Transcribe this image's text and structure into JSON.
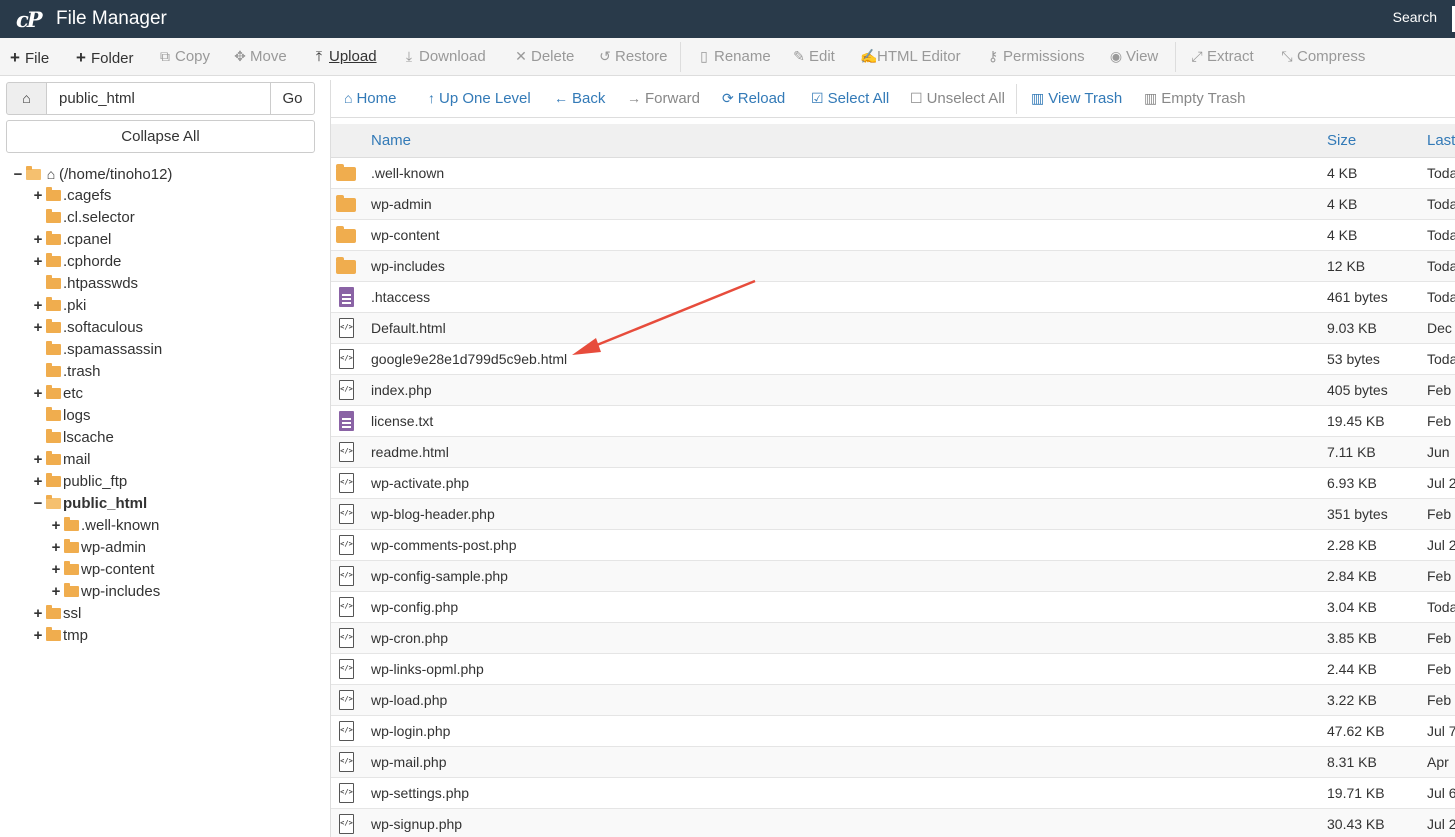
{
  "header": {
    "logo": "cP",
    "title": "File Manager",
    "search_label": "Search"
  },
  "toolbar": [
    {
      "label": "File",
      "icon": "plus-icon",
      "glyph": "+",
      "state": "on"
    },
    {
      "label": "Folder",
      "icon": "plus-icon",
      "glyph": "+",
      "state": "on"
    },
    {
      "label": "Copy",
      "icon": "copy-icon",
      "glyph": "⧉",
      "state": "off"
    },
    {
      "label": "Move",
      "icon": "move-icon",
      "glyph": "✥",
      "state": "off"
    },
    {
      "label": "Upload",
      "icon": "upload-icon",
      "glyph": "⤒",
      "state": "on"
    },
    {
      "label": "Download",
      "icon": "download-icon",
      "glyph": "⤓",
      "state": "off"
    },
    {
      "label": "Delete",
      "icon": "times-icon",
      "glyph": "✕",
      "state": "off"
    },
    {
      "label": "Restore",
      "icon": "undo-icon",
      "glyph": "↺",
      "state": "off"
    },
    {
      "label": "Rename",
      "icon": "file-icon",
      "glyph": "▯",
      "state": "off"
    },
    {
      "label": "Edit",
      "icon": "pencil-icon",
      "glyph": "✎",
      "state": "off"
    },
    {
      "label": "HTML Editor",
      "icon": "edit-icon",
      "glyph": "✍",
      "state": "off"
    },
    {
      "label": "Permissions",
      "icon": "key-icon",
      "glyph": "⚷",
      "state": "off"
    },
    {
      "label": "View",
      "icon": "eye-icon",
      "glyph": "◉",
      "state": "off"
    },
    {
      "label": "Extract",
      "icon": "expand-icon",
      "glyph": "⤢",
      "state": "off"
    },
    {
      "label": "Compress",
      "icon": "compress-icon",
      "glyph": "⤡",
      "state": "off"
    }
  ],
  "path": {
    "value": "public_html",
    "go_label": "Go"
  },
  "collapse_label": "Collapse All",
  "tree": [
    {
      "label": "(/home/tinoho12)",
      "toggle": "−",
      "open": true,
      "home": true,
      "bold": false,
      "depth": 0
    },
    {
      "label": ".cagefs",
      "toggle": "+",
      "open": false,
      "depth": 1
    },
    {
      "label": ".cl.selector",
      "toggle": "",
      "open": false,
      "depth": 1
    },
    {
      "label": ".cpanel",
      "toggle": "+",
      "open": false,
      "depth": 1
    },
    {
      "label": ".cphorde",
      "toggle": "+",
      "open": false,
      "depth": 1
    },
    {
      "label": ".htpasswds",
      "toggle": "",
      "open": false,
      "depth": 1
    },
    {
      "label": ".pki",
      "toggle": "+",
      "open": false,
      "depth": 1
    },
    {
      "label": ".softaculous",
      "toggle": "+",
      "open": false,
      "depth": 1
    },
    {
      "label": ".spamassassin",
      "toggle": "",
      "open": false,
      "depth": 1
    },
    {
      "label": ".trash",
      "toggle": "",
      "open": false,
      "depth": 1
    },
    {
      "label": "etc",
      "toggle": "+",
      "open": false,
      "depth": 1
    },
    {
      "label": "logs",
      "toggle": "",
      "open": false,
      "depth": 1
    },
    {
      "label": "lscache",
      "toggle": "",
      "open": false,
      "depth": 1
    },
    {
      "label": "mail",
      "toggle": "+",
      "open": false,
      "depth": 1
    },
    {
      "label": "public_ftp",
      "toggle": "+",
      "open": false,
      "depth": 1
    },
    {
      "label": "public_html",
      "toggle": "−",
      "open": true,
      "bold": true,
      "depth": 1
    },
    {
      "label": ".well-known",
      "toggle": "+",
      "open": false,
      "depth": 2
    },
    {
      "label": "wp-admin",
      "toggle": "+",
      "open": false,
      "depth": 2
    },
    {
      "label": "wp-content",
      "toggle": "+",
      "open": false,
      "depth": 2
    },
    {
      "label": "wp-includes",
      "toggle": "+",
      "open": false,
      "depth": 2
    },
    {
      "label": "ssl",
      "toggle": "+",
      "open": false,
      "depth": 1
    },
    {
      "label": "tmp",
      "toggle": "+",
      "open": false,
      "depth": 1
    }
  ],
  "nav": [
    {
      "label": "Home",
      "icon": "home-icon",
      "glyph": "⌂",
      "state": "on"
    },
    {
      "label": "Up One Level",
      "icon": "level-up-icon",
      "glyph": "↑",
      "state": "on"
    },
    {
      "label": "Back",
      "icon": "arrow-left-icon",
      "glyph": "←",
      "state": "on"
    },
    {
      "label": "Forward",
      "icon": "arrow-right-icon",
      "glyph": "→",
      "state": "off"
    },
    {
      "label": "Reload",
      "icon": "refresh-icon",
      "glyph": "⟳",
      "state": "on"
    },
    {
      "label": "Select All",
      "icon": "checkbox-checked-icon",
      "glyph": "☑",
      "state": "on"
    },
    {
      "label": "Unselect All",
      "icon": "checkbox-empty-icon",
      "glyph": "☐",
      "state": "off"
    },
    {
      "label": "View Trash",
      "icon": "trash-icon",
      "glyph": "🗑",
      "state": "on"
    },
    {
      "label": "Empty Trash",
      "icon": "trash-icon",
      "glyph": "🗑",
      "state": "off"
    }
  ],
  "table": {
    "headers": {
      "name": "Name",
      "size": "Size",
      "last": "Last"
    },
    "rows": [
      {
        "name": ".well-known",
        "size": "4 KB",
        "date": "Toda",
        "type": "folder"
      },
      {
        "name": "wp-admin",
        "size": "4 KB",
        "date": "Toda",
        "type": "folder"
      },
      {
        "name": "wp-content",
        "size": "4 KB",
        "date": "Toda",
        "type": "folder"
      },
      {
        "name": "wp-includes",
        "size": "12 KB",
        "date": "Toda",
        "type": "folder"
      },
      {
        "name": ".htaccess",
        "size": "461 bytes",
        "date": "Toda",
        "type": "text"
      },
      {
        "name": "Default.html",
        "size": "9.03 KB",
        "date": "Dec",
        "type": "code"
      },
      {
        "name": "google9e28e1d799d5c9eb.html",
        "size": "53 bytes",
        "date": "Toda",
        "type": "code"
      },
      {
        "name": "index.php",
        "size": "405 bytes",
        "date": "Feb",
        "type": "code"
      },
      {
        "name": "license.txt",
        "size": "19.45 KB",
        "date": "Feb",
        "type": "text"
      },
      {
        "name": "readme.html",
        "size": "7.11 KB",
        "date": "Jun",
        "type": "code"
      },
      {
        "name": "wp-activate.php",
        "size": "6.93 KB",
        "date": "Jul 2",
        "type": "code"
      },
      {
        "name": "wp-blog-header.php",
        "size": "351 bytes",
        "date": "Feb",
        "type": "code"
      },
      {
        "name": "wp-comments-post.php",
        "size": "2.28 KB",
        "date": "Jul 2",
        "type": "code"
      },
      {
        "name": "wp-config-sample.php",
        "size": "2.84 KB",
        "date": "Feb",
        "type": "code"
      },
      {
        "name": "wp-config.php",
        "size": "3.04 KB",
        "date": "Toda",
        "type": "code"
      },
      {
        "name": "wp-cron.php",
        "size": "3.85 KB",
        "date": "Feb",
        "type": "code"
      },
      {
        "name": "wp-links-opml.php",
        "size": "2.44 KB",
        "date": "Feb",
        "type": "code"
      },
      {
        "name": "wp-load.php",
        "size": "3.22 KB",
        "date": "Feb",
        "type": "code"
      },
      {
        "name": "wp-login.php",
        "size": "47.62 KB",
        "date": "Jul 7",
        "type": "code"
      },
      {
        "name": "wp-mail.php",
        "size": "8.31 KB",
        "date": "Apr",
        "type": "code"
      },
      {
        "name": "wp-settings.php",
        "size": "19.71 KB",
        "date": "Jul 6",
        "type": "code"
      },
      {
        "name": "wp-signup.php",
        "size": "30.43 KB",
        "date": "Jul 2",
        "type": "code"
      }
    ]
  },
  "annotation": {
    "color": "#e74c3c"
  },
  "colors": {
    "header_bg": "#293a4a",
    "link": "#337ab7",
    "folder": "#f0ad4e",
    "text_file": "#8a63a5"
  }
}
